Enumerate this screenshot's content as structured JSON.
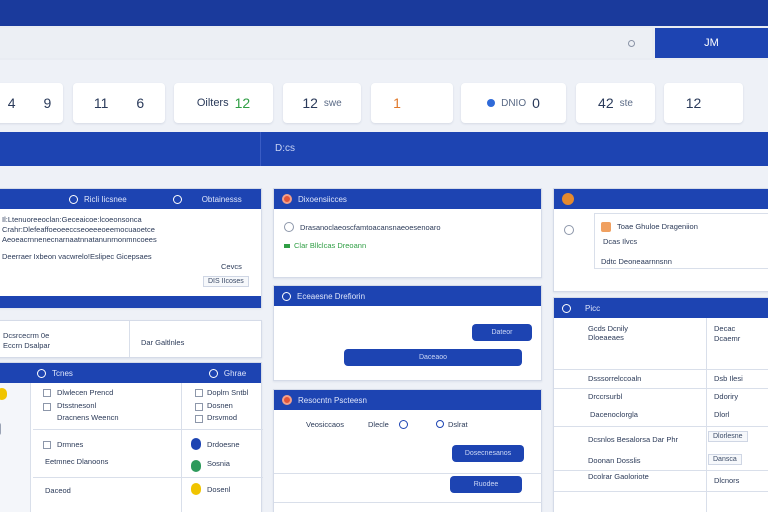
{
  "header": {
    "search_button_label": "JM",
    "search_placeholder": ""
  },
  "stats": [
    {
      "v1": "4",
      "v2": "9",
      "lbl": ""
    },
    {
      "v1": "11",
      "v2": "6",
      "lbl": ""
    },
    {
      "v1": "Oilters",
      "v2": "12",
      "lbl": ""
    },
    {
      "v1": "12",
      "v2": "",
      "lbl": "swe"
    },
    {
      "v1": "1",
      "v2": "",
      "lbl": ""
    },
    {
      "v1": "",
      "v2": "0",
      "lbl": "DNIO"
    },
    {
      "v1": "42",
      "v2": "",
      "lbl": "ste"
    },
    {
      "v1": "12",
      "v2": "",
      "lbl": ""
    }
  ],
  "banner": {
    "label": "D:cs"
  },
  "panels": {
    "p1": {
      "title": "Ricli Iicsnee",
      "right_title": "Obtainesss",
      "lines": [
        "Il:Ltenuoreeoclan:Geceaicoe:lcoeonsonca",
        "Crahr:Dlefeaffoeoeeccseoeeeoeemocuaoetce",
        "Aeoeacrnnenecnarnaatnnatanunrnonmncoees",
        "Deerraer Ixbeon vacwrelo!Eslipec Gicepsaes",
        "Cevcs"
      ],
      "pill": "DIS IIcoses"
    },
    "p2": {
      "left_label": "Dcsrcecrm 0e",
      "left_sub": "Eccrn Dsalpar",
      "right_label": "Dar Galtlnles"
    },
    "p3": {
      "title": "Tcnes",
      "right_title": "Ghrae",
      "rows": [
        {
          "label": "Dlwlecen Prencd",
          "right": "Doplrn Sntbl"
        },
        {
          "label": "Dtsstnesonl",
          "right": "Dosnen"
        },
        {
          "label": "Dracnens Weencn",
          "right": "Drsvmod"
        },
        {
          "label": "Drmnes",
          "right": "Drdoesne"
        },
        {
          "label": "Eetmnec Dlanoons",
          "right": "Sosnia"
        },
        {
          "label": "Daceod",
          "right": "Dosenl"
        }
      ]
    },
    "p4": {
      "title": "Dixoensiicces",
      "line1": "Drasanoclaeoscfamtoacansnaeoesenoaro",
      "line2": "Clar Bllclcas Dreoann"
    },
    "p5": {
      "title": "Eceaesne Drefiorin",
      "button": "Dateor",
      "wide_button": "Daceaoo"
    },
    "p6": {
      "title": "Resocntn Pscteesn",
      "items": [
        "Veosiccaos",
        "Dlecle",
        "Dslrat"
      ],
      "button1": "Dosecnesanos",
      "button2": "Ruodee"
    },
    "p7": {
      "title": "Toae Ghuloe Drageniion",
      "sub": "Dcas Ilvcs",
      "line": "Ddtc Deoneaarnnsnn"
    },
    "p8": {
      "title": "Picc",
      "rows": [
        {
          "a": "Gcds Dcnily",
          "b": "Dloeaeaes",
          "c": "Decac",
          "d": "Dcaemr"
        },
        {
          "a": "Dsssorrelccoaln",
          "b": "",
          "c": "Dsb Ilesi",
          "d": ""
        },
        {
          "a": "Drccrsurbl",
          "b": "",
          "c": "Ddoriry",
          "d": ""
        },
        {
          "a": "Dacenoclorgla",
          "b": "",
          "c": "Dlorl",
          "d": ""
        },
        {
          "a": "Dcsnlos Besalorsa Dar Phr",
          "b": "",
          "c": "Dlorlesne",
          "d": ""
        },
        {
          "a": "Doonan Dosslis",
          "b": "",
          "c": "Dansca",
          "d": ""
        },
        {
          "a": "Dcolrar Gaoloriote",
          "b": "",
          "c": "Dlcnors",
          "d": ""
        }
      ]
    }
  }
}
